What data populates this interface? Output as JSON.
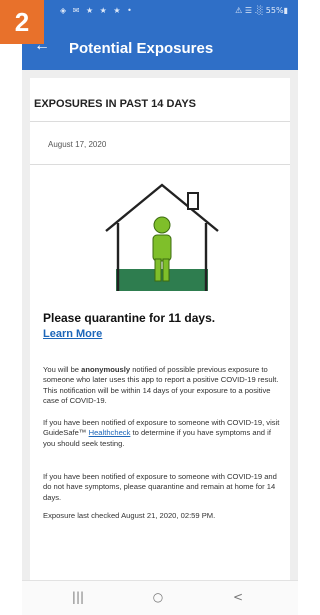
{
  "step_badge": "2",
  "status_bar": {
    "left": "◈ ✉ ★ ★ ★ •",
    "right": "⚠ ☰ .░ 55%▮"
  },
  "header": {
    "back_glyph": "←",
    "title": "Potential Exposures"
  },
  "section": {
    "title": "EXPOSURES IN PAST 14 DAYS",
    "date": "August 17, 2020"
  },
  "illustration": {
    "icon": "house-with-person-icon",
    "colors": {
      "person": "#7fbf2a",
      "ground": "#2e7d4f",
      "outline": "#222222"
    }
  },
  "message": {
    "headline": "Please quarantine for 11 days.",
    "learn_more": "Learn More",
    "p1_a": "You will be ",
    "p1_bold": "anonymously",
    "p1_b": " notified of possible previous exposure to someone who later uses this app to report a positive COVID-19 result. This notification will be within 14 days of your exposure to a positive case of COVID-19.",
    "p2_a": "If you have been notified of exposure to someone with COVID-19, visit GuideSafe™ ",
    "p2_link": "Healthcheck",
    "p2_b": " to determine if you have symptoms and if you should seek testing.",
    "p3": "If you have been notified of exposure to someone with COVID-19 and do not have symptoms, please quarantine and remain at home for 14 days.",
    "last_checked": "Exposure last checked August 21, 2020, 02:59 PM."
  },
  "nav": {
    "recent": "|||",
    "home": "○",
    "back": "<"
  },
  "colors": {
    "app_bar": "#2f6fc7",
    "badge": "#e8712b",
    "link": "#1c66b9"
  }
}
